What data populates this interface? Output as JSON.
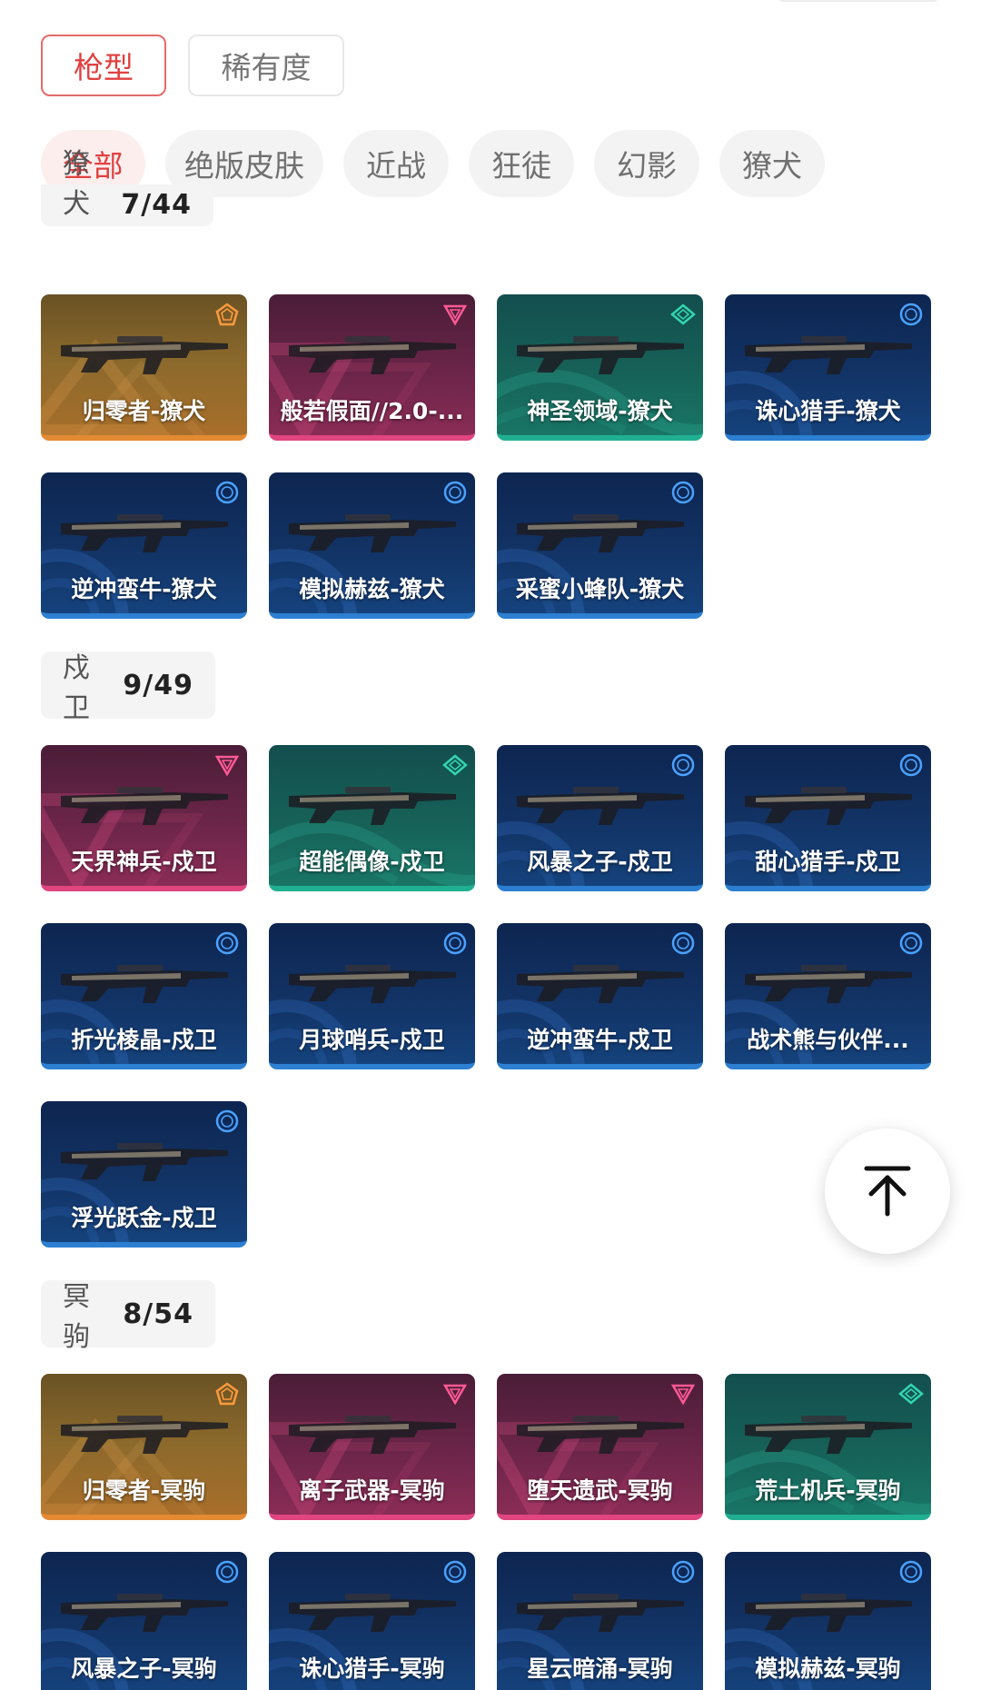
{
  "primary_tabs": [
    {
      "label": "枪型",
      "active": true
    },
    {
      "label": "稀有度",
      "active": false
    }
  ],
  "categories": [
    {
      "label": "全部",
      "active": true
    },
    {
      "label": "绝版皮肤"
    },
    {
      "label": "近战"
    },
    {
      "label": "狂徒"
    },
    {
      "label": "幻影"
    },
    {
      "label": "獠犬"
    }
  ],
  "sections": [
    {
      "name": "獠犬",
      "count": "7/44",
      "items": [
        {
          "name": "归零者-獠犬",
          "tier": "gold"
        },
        {
          "name": "般若假面//2.0-...",
          "tier": "pink"
        },
        {
          "name": "神圣领域-獠犬",
          "tier": "teal"
        },
        {
          "name": "诛心猎手-獠犬",
          "tier": "blue"
        },
        {
          "name": "逆冲蛮牛-獠犬",
          "tier": "blue"
        },
        {
          "name": "模拟赫兹-獠犬",
          "tier": "blue"
        },
        {
          "name": "采蜜小蜂队-獠犬",
          "tier": "blue"
        }
      ]
    },
    {
      "name": "戍卫",
      "count": "9/49",
      "items": [
        {
          "name": "天界神兵-戍卫",
          "tier": "pink"
        },
        {
          "name": "超能偶像-戍卫",
          "tier": "teal"
        },
        {
          "name": "风暴之子-戍卫",
          "tier": "blue"
        },
        {
          "name": "甜心猎手-戍卫",
          "tier": "blue"
        },
        {
          "name": "折光棱晶-戍卫",
          "tier": "blue"
        },
        {
          "name": "月球哨兵-戍卫",
          "tier": "blue"
        },
        {
          "name": "逆冲蛮牛-戍卫",
          "tier": "blue"
        },
        {
          "name": "战术熊与伙伴...",
          "tier": "blue"
        },
        {
          "name": "浮光跃金-戍卫",
          "tier": "blue"
        }
      ]
    },
    {
      "name": "冥驹",
      "count": "8/54",
      "items": [
        {
          "name": "归零者-冥驹",
          "tier": "gold"
        },
        {
          "name": "离子武器-冥驹",
          "tier": "pink"
        },
        {
          "name": "堕天遗武-冥驹",
          "tier": "pink"
        },
        {
          "name": "荒土机兵-冥驹",
          "tier": "teal"
        },
        {
          "name": "风暴之子-冥驹",
          "tier": "blue"
        },
        {
          "name": "诛心猎手-冥驹",
          "tier": "blue"
        },
        {
          "name": "星云暗涌-冥驹",
          "tier": "blue"
        },
        {
          "name": "模拟赫兹-冥驹",
          "tier": "blue"
        }
      ]
    }
  ],
  "tier_colors": {
    "gold": "#e48a32",
    "pink": "#e0457f",
    "teal": "#20b091",
    "blue": "#2c7fd1"
  },
  "icons": {
    "gold": "pentagon-rarity-icon",
    "pink": "triangle-rarity-icon",
    "teal": "diamond-rarity-icon",
    "blue": "circle-rarity-icon",
    "back_to_top": "arrow-up-to-top-icon"
  }
}
